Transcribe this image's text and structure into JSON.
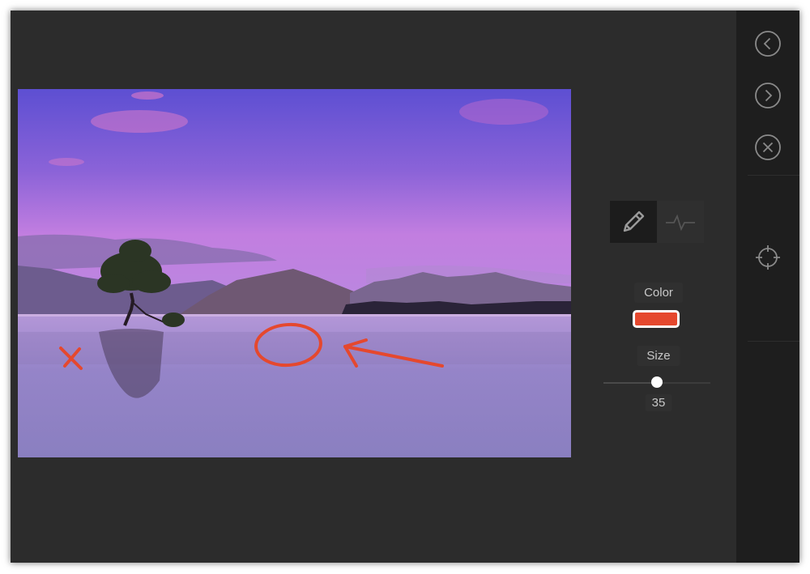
{
  "editor": {
    "color_label": "Color",
    "size_label": "Size",
    "size_value": "35",
    "size_level": 0.5,
    "selected_color": "#e5482e",
    "active_tool": "pencil-icon",
    "inactive_tool": "waveform-icon"
  },
  "sidebar": {
    "buttons": [
      "back-icon",
      "forward-icon",
      "close-icon",
      "crosshair-icon"
    ]
  },
  "annotations": {
    "stroke_color": "#e5482e",
    "marks": [
      "x-mark",
      "circle-mark",
      "arrow-mark"
    ]
  }
}
